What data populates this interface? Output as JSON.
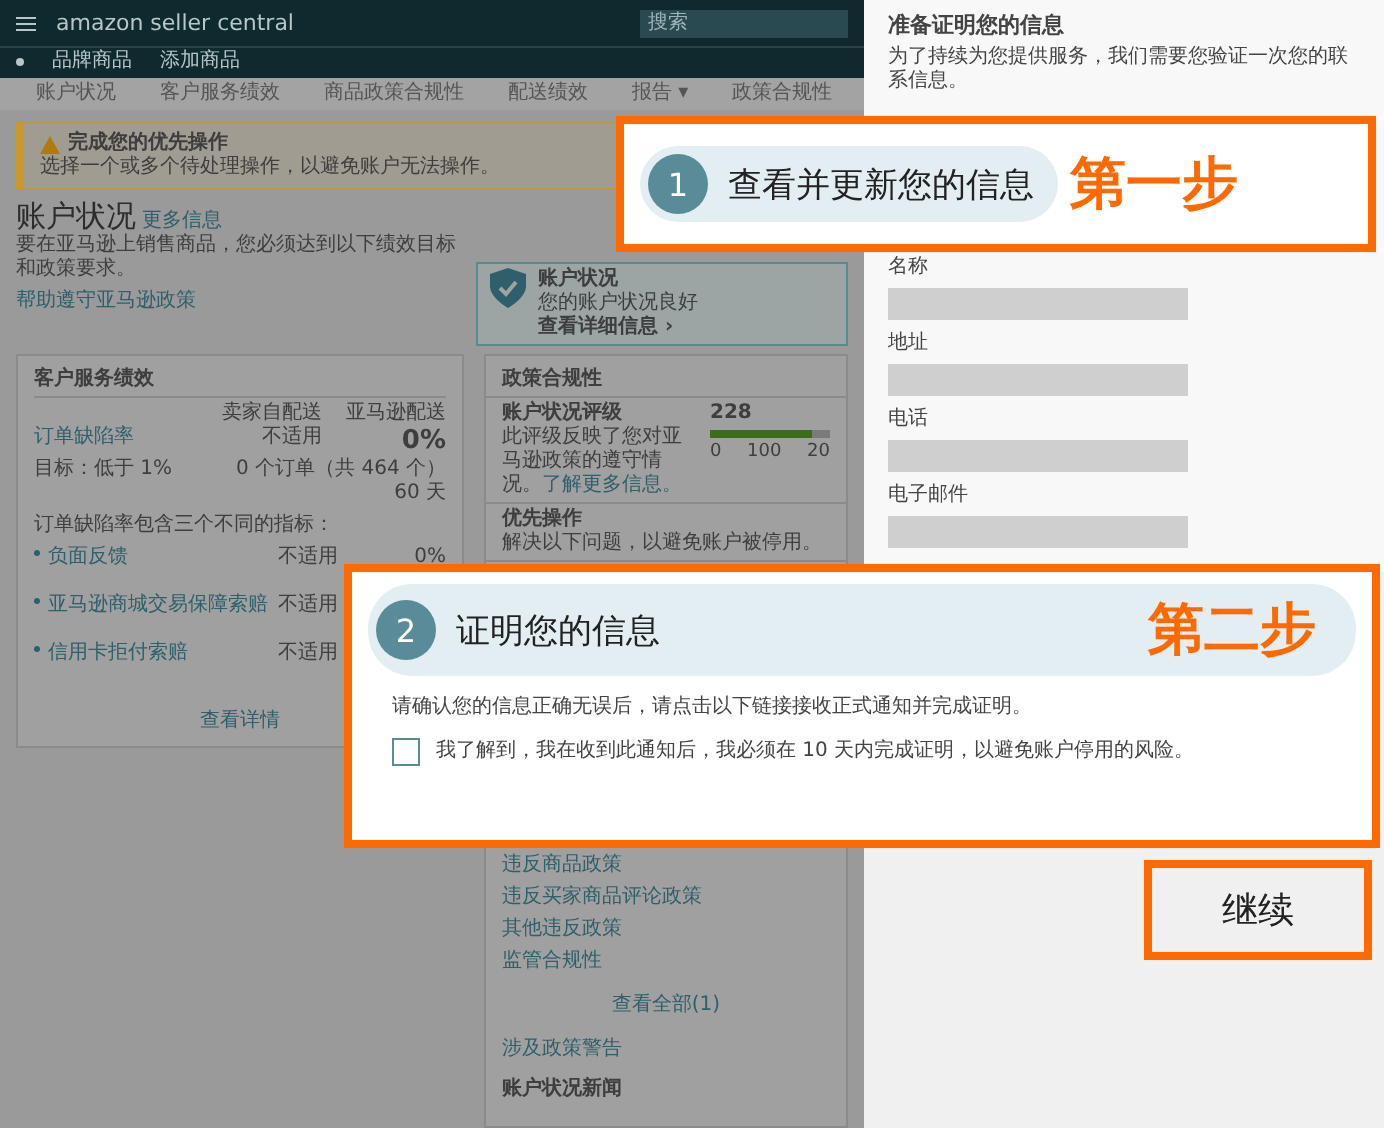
{
  "topbar": {
    "logo": "amazon seller central",
    "search_placeholder": "搜索"
  },
  "subnav": [
    "品牌商品",
    "添加商品"
  ],
  "tabs": [
    "账户状况",
    "客户服务绩效",
    "商品政策合规性",
    "配送绩效",
    "报告 ▾",
    "政策合规性"
  ],
  "banner": {
    "title": "完成您的优先操作",
    "text": "选择一个或多个待处理操作，以避免账户无法操作。"
  },
  "account_health": {
    "title": "账户状况",
    "link": "更多信息",
    "paragraph": "要在亚马逊上销售商品，您必须达到以下绩效目标和政策要求。",
    "help_link": "帮助遵守亚马逊政策"
  },
  "status_card": {
    "title": "账户状况",
    "text": "您的账户状况良好",
    "link": "查看详细信息 ›"
  },
  "customer_service": {
    "title": "客户服务绩效",
    "columns": [
      "卖家自配送",
      "亚马逊配送"
    ],
    "metric": {
      "name": "订单缺陷率",
      "target": "目标：低于 1%",
      "fbm": "不适用",
      "fba": "0%",
      "detail": "0 个订单（共 464 个）",
      "period": "60 天"
    },
    "intro": "订单缺陷率包含三个不同的指标：",
    "items": [
      {
        "name": "负面反馈",
        "fbm": "不适用",
        "fba": "0%"
      },
      {
        "name": "亚马逊商城交易保障索赔",
        "fbm": "不适用"
      },
      {
        "name": "信用卡拒付索赔",
        "fbm": "不适用"
      }
    ],
    "more": "查看详情"
  },
  "policy": {
    "title": "政策合规性",
    "rating_title": "账户状况评级",
    "rating_text": "此评级反映了您对亚马逊政策的遵守情况。",
    "rating_link": "了解更多信息。",
    "score": "228",
    "level": 0.85,
    "ticks": [
      "0",
      "100",
      "20"
    ],
    "priority_title": "优先操作",
    "priority_text": "解决以下问题，以避免账户被停用。",
    "issues": [
      "违反商品政策",
      "违反买家商品评论政策",
      "其他违反政策",
      "监管合规性"
    ],
    "view_all": "查看全部(1)",
    "warnings": "涉及政策警告",
    "news": "账户状况新闻"
  },
  "panel": {
    "title": "准备证明您的信息",
    "paragraph": "为了持续为您提供服务，我们需要您验证一次您的联系信息。",
    "fields": [
      {
        "label": "名称"
      },
      {
        "label": "地址"
      },
      {
        "label": "电话"
      },
      {
        "label": "电子邮件"
      }
    ]
  },
  "steps": [
    {
      "number": "1",
      "title": "查看并更新您的信息",
      "tag": "第一步"
    },
    {
      "number": "2",
      "title": "证明您的信息",
      "tag": "第二步",
      "text": "请确认您的信息正确无误后，请点击以下链接接收正式通知并完成证明。",
      "checkbox": {
        "label": "我了解到，我在收到此通知后，我必须在 10 天内完成证明，以避免账户停用的风险。",
        "checked": false
      }
    }
  ],
  "continue_button": "继续"
}
